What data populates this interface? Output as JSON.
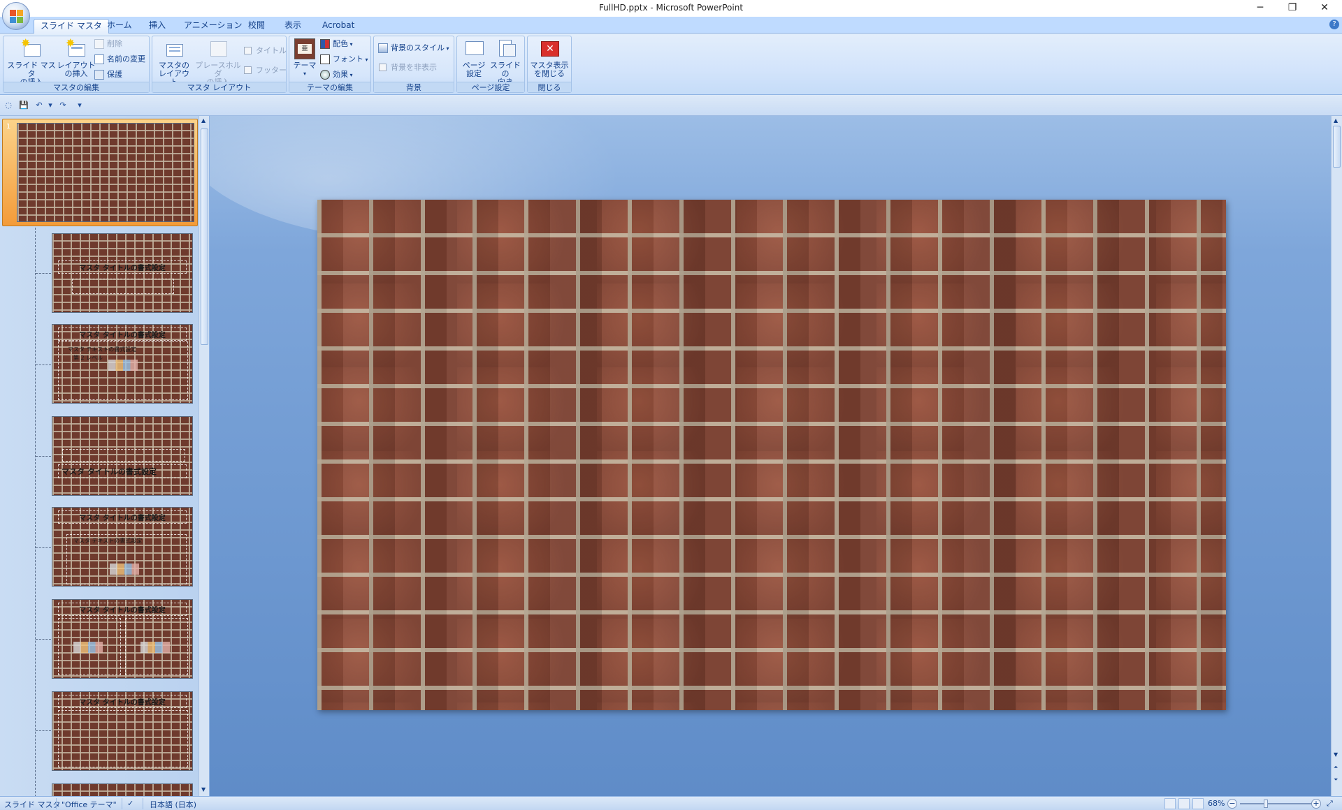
{
  "window": {
    "title": "FullHD.pptx - Microsoft PowerPoint",
    "controls": {
      "minimize": "─",
      "restore": "❐",
      "close": "✕"
    }
  },
  "tabs": [
    {
      "label": "スライド マスタ",
      "active": true
    },
    {
      "label": "ホーム"
    },
    {
      "label": "挿入"
    },
    {
      "label": "アニメーション"
    },
    {
      "label": "校閲"
    },
    {
      "label": "表示"
    },
    {
      "label": "Acrobat"
    }
  ],
  "ribbon": {
    "master_edit": {
      "label": "マスタの編集",
      "insert_master_l1": "スライド マスタ",
      "insert_master_l2": "の挿入",
      "insert_layout_l1": "レイアウト",
      "insert_layout_l2": "の挿入",
      "delete": "削除",
      "rename": "名前の変更",
      "preserve": "保護"
    },
    "master_layout": {
      "label": "マスタ レイアウト",
      "master_layout_l1": "マスタの",
      "master_layout_l2": "レイアウト",
      "placeholder_l1": "プレースホルダ",
      "placeholder_l2": "の挿入",
      "title_chk": "タイトル",
      "footer_chk": "フッター"
    },
    "theme_edit": {
      "label": "テーマの編集",
      "themes": "テーマ",
      "colors": "配色",
      "fonts": "フォント",
      "effects": "効果"
    },
    "background": {
      "label": "背景",
      "styles": "背景のスタイル",
      "hide": "背景を非表示"
    },
    "page_setup": {
      "label": "ページ設定",
      "page_setup_l1": "ページ",
      "page_setup_l2": "設定",
      "orientation_l1": "スライドの",
      "orientation_l2": "向き"
    },
    "close": {
      "label": "閉じる",
      "close_l1": "マスタ表示",
      "close_l2": "を閉じる"
    }
  },
  "thumbnails": {
    "master_number": "1",
    "layout1_title": "マスタ タイトルの書式設定",
    "layout2_title": "マスタ タイトルの書式設定",
    "layout2_text_l1": "マスタ テキストの書式設定",
    "layout2_text_l2": "第 2 レベル",
    "layout3_title": "マスタ タイトルの書式設定",
    "layout4_title": "マスタ タイトルの書式設定",
    "layout4_text": "マスタ テキストの書式設定",
    "layout5_title": "マスタ タイトルの書式設定",
    "layout6_title": "マスタ タイトルの書式設定"
  },
  "statusbar": {
    "view": "スライド マスタ",
    "theme": "\"Office テーマ\"",
    "language": "日本語 (日本)",
    "zoom": "68%",
    "zoom_level": 0.68
  },
  "colors": {
    "ribbon_bg": "#d3e4fb",
    "accent_orange": "#f39b39",
    "workarea_bg": "#5f8cc8",
    "close_red": "#d9302b"
  }
}
